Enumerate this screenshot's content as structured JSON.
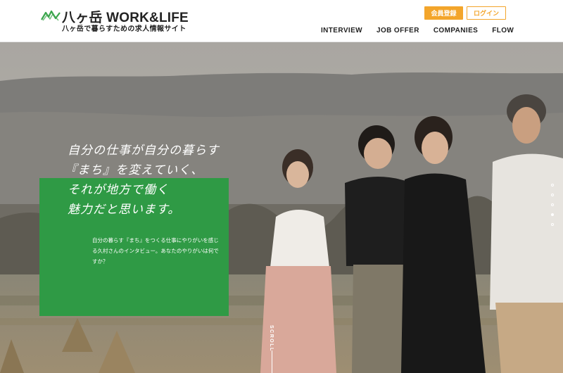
{
  "header": {
    "logo_title": "八ヶ岳 WORK&LIFE",
    "logo_sub": "八ヶ岳で暮らすための求人情報サイト",
    "register_label": "会員登録",
    "login_label": "ログイン",
    "nav": [
      {
        "label": "INTERVIEW"
      },
      {
        "label": "JOB OFFER"
      },
      {
        "label": "COMPANIES"
      },
      {
        "label": "FLOW"
      }
    ]
  },
  "hero": {
    "catch_lines": [
      "自分の仕事が自分の暮らす",
      "『まち』を変えていく、",
      "それが地方で働く",
      "魅力だと思います。"
    ],
    "lead_lines": [
      "自分の暮らす『まち』をつくる仕事にやりがいを感じ",
      "る久村さんのインタビュー。あなたのやりがいは何で",
      "すか？"
    ],
    "scroll_label": "SCROLL",
    "slide_count": 5,
    "active_slide": 4
  },
  "colors": {
    "accent_orange": "#f3a52b",
    "green_box": "#2f9a45",
    "logo_green": "#3aa54c"
  }
}
